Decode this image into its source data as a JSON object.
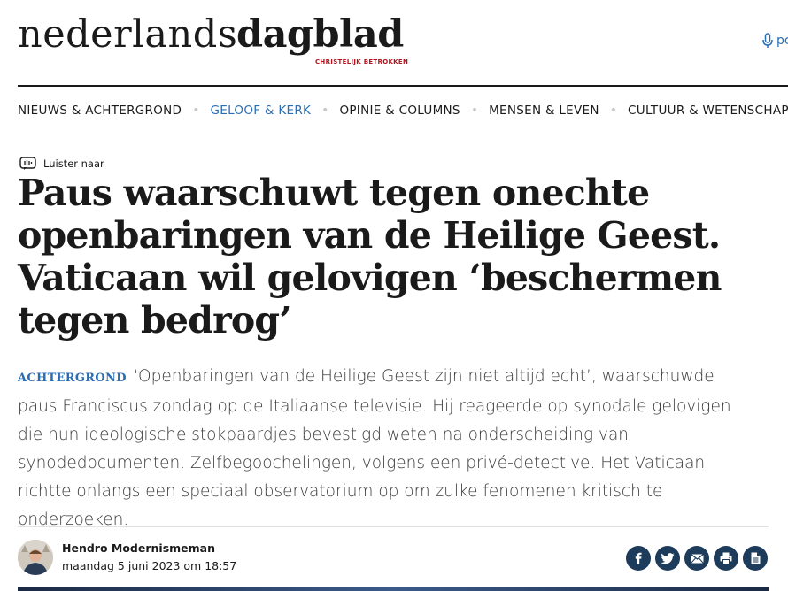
{
  "logo": {
    "part1": "nederlands",
    "part2": "dagblad",
    "tagline": "CHRISTELIJK BETROKKEN"
  },
  "header": {
    "podcast_label": "pc"
  },
  "nav": {
    "items": [
      {
        "label": "NIEUWS & ACHTERGROND",
        "active": false
      },
      {
        "label": "GELOOF & KERK",
        "active": true
      },
      {
        "label": "OPINIE & COLUMNS",
        "active": false
      },
      {
        "label": "MENSEN & LEVEN",
        "active": false
      },
      {
        "label": "CULTUUR & WETENSCHAP",
        "active": false
      }
    ]
  },
  "article": {
    "listen_label": "Luister naar",
    "headline": "Paus waarschuwt tegen onechte openbaringen van de Heilige Geest. Vaticaan wil gelovigen ‘beschermen tegen bedrog’",
    "kicker": "ACHTERGROND",
    "intro": "‘Openbaringen van de Heilige Geest zijn niet altijd echt’, waarschuwde paus Franciscus zondag op de Italiaanse televisie. Hij reageerde op synodale gelovigen die hun ideologische stokpaardjes bevestigd weten na onderscheiding van synodedocumenten. Zelfbegoochelingen, volgens een privé-detective. Het Vaticaan richtte onlangs een speciaal observatorium op om zulke fenomenen kritisch te onderzoeken.",
    "author": "Hendro Modernismeman",
    "date": "maandag 5 juni 2023 om 18:57"
  },
  "share": {
    "icons": [
      "facebook-icon",
      "twitter-icon",
      "mail-icon",
      "print-icon",
      "document-icon"
    ]
  },
  "colors": {
    "accent": "#2a6db5",
    "brand_red": "#b5121b",
    "share_bg": "#1d3b5a"
  }
}
